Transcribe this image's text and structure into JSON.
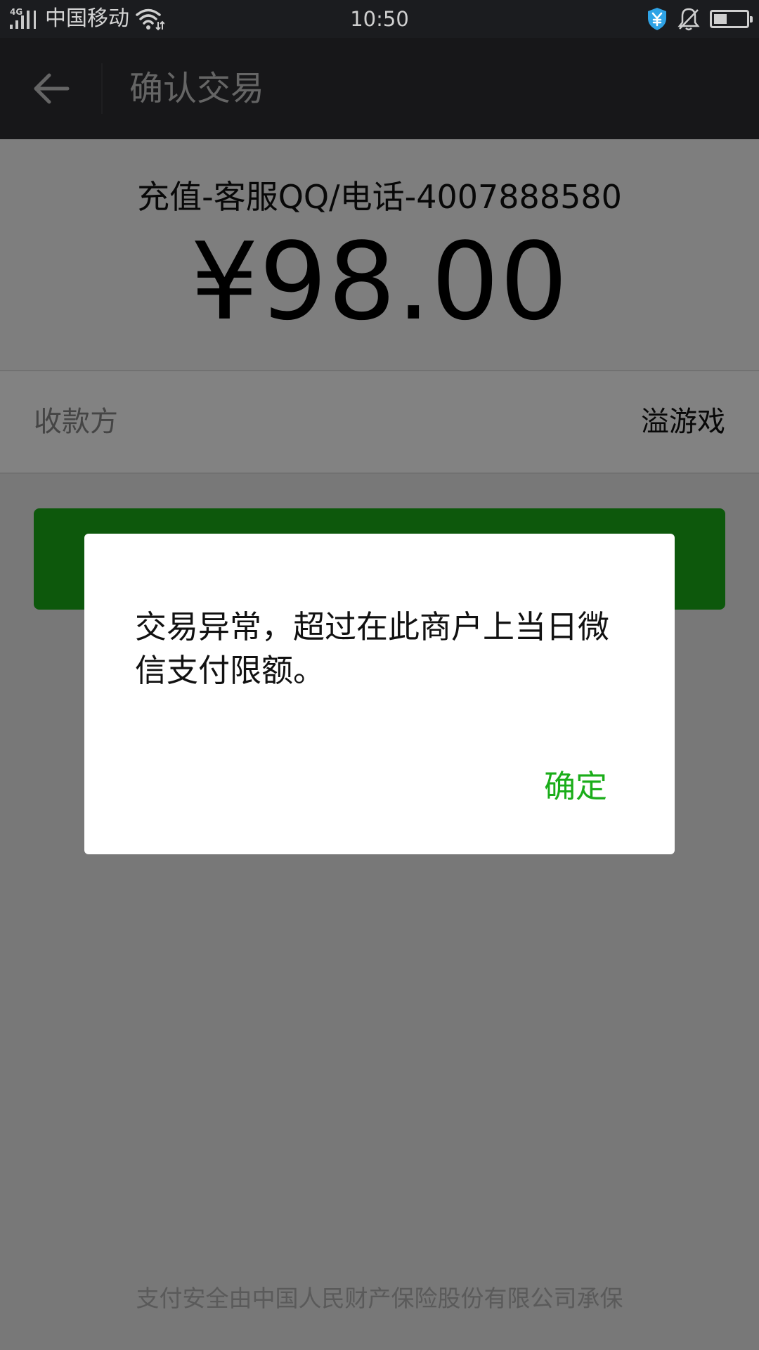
{
  "status_bar": {
    "network_type": "4G",
    "carrier": "中国移动",
    "time": "10:50",
    "battery_level": 0.4,
    "icons": [
      "signal-icon",
      "wifi-icon",
      "security-shield-icon",
      "bell-muted-icon",
      "battery-icon"
    ]
  },
  "header": {
    "title": "确认交易",
    "back_icon": "back-arrow-icon"
  },
  "order": {
    "product": "充值-客服QQ/电话-4007888580",
    "amount": "¥98.00"
  },
  "payee": {
    "label": "收款方",
    "value": "溢游戏"
  },
  "footer": {
    "insurance_note": "支付安全由中国人民财产保险股份有限公司承保"
  },
  "dialog": {
    "message": "交易异常，超过在此商户上当日微信支付限额。",
    "confirm_label": "确定"
  },
  "colors": {
    "accent_green": "#1aad19",
    "title_bar": "#2d2e32",
    "status_bar": "#1b1c1f"
  }
}
